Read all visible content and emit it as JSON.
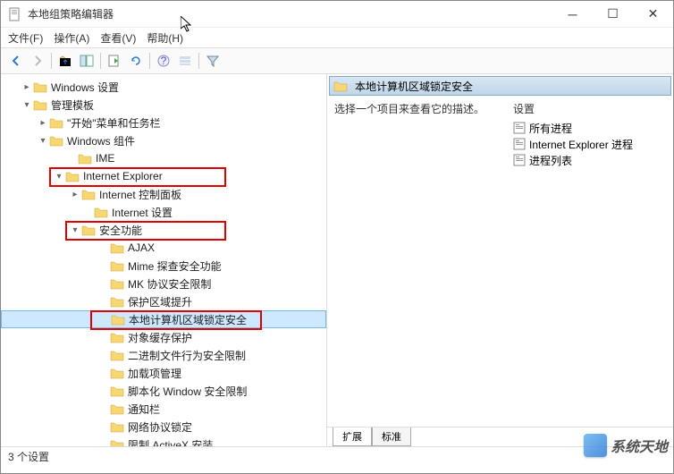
{
  "window": {
    "title": "本地组策略编辑器"
  },
  "menu": {
    "file": "文件(F)",
    "action": "操作(A)",
    "view": "查看(V)",
    "help": "帮助(H)"
  },
  "tree": {
    "windows_settings": "Windows 设置",
    "admin_templates": "管理模板",
    "start_taskbar": "\"开始\"菜单和任务栏",
    "windows_components": "Windows 组件",
    "ime": "IME",
    "ie": "Internet Explorer",
    "ie_control_panel": "Internet 控制面板",
    "ie_settings": "Internet 设置",
    "security_features": "安全功能",
    "ajax": "AJAX",
    "mime": "Mime 探查安全功能",
    "mk": "MK 协议安全限制",
    "zone_elevation": "保护区域提升",
    "local_machine_zone": "本地计算机区域锁定安全",
    "object_cache": "对象缓存保护",
    "binary": "二进制文件行为安全限制",
    "addon_mgmt": "加载项管理",
    "scripted_window": "脚本化 Window 安全限制",
    "notification_bar": "通知栏",
    "network_protocol": "网络协议锁定",
    "restrict_activex": "限制 ActiveX 安装"
  },
  "detail": {
    "header": "本地计算机区域锁定安全",
    "description": "选择一个项目来查看它的描述。",
    "settings_label": "设置",
    "items": {
      "all_processes": "所有进程",
      "ie_process": "Internet Explorer 进程",
      "process_list": "进程列表"
    }
  },
  "tabs": {
    "extended": "扩展",
    "standard": "标准"
  },
  "status": {
    "text": "3 个设置"
  },
  "watermark": {
    "text": "系统天地"
  }
}
